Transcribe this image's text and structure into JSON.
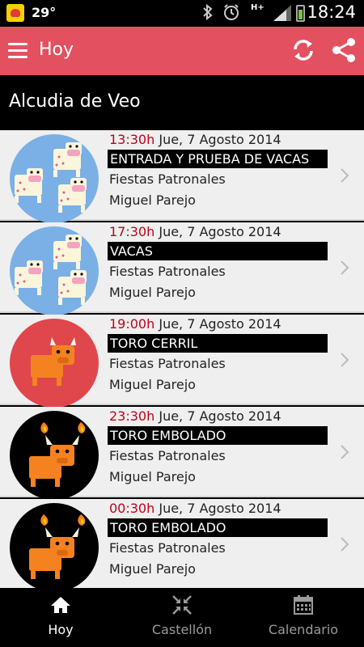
{
  "status_bar": {
    "temperature": "29°",
    "network": "H+",
    "time": "18:24",
    "icons": [
      "notification-icon",
      "bluetooth-icon",
      "alarm-icon",
      "signal-icon",
      "battery-icon"
    ]
  },
  "app_bar": {
    "title": "Hoy",
    "color": "#e3505f",
    "actions": [
      "refresh-icon",
      "share-icon"
    ]
  },
  "location": "Alcudia de Veo",
  "events": [
    {
      "time": "13:30h",
      "date": "Jue, 7 Agosto 2014",
      "name": "ENTRADA Y PRUEBA DE VACAS",
      "category": "Fiestas Patronales",
      "venue": "Miguel Parejo",
      "icon": "cows-icon"
    },
    {
      "time": "17:30h",
      "date": "Jue, 7 Agosto 2014",
      "name": "VACAS",
      "category": "Fiestas Patronales",
      "venue": "Miguel Parejo",
      "icon": "cows-icon"
    },
    {
      "time": "19:00h",
      "date": "Jue, 7 Agosto 2014",
      "name": "TORO CERRIL",
      "category": "Fiestas Patronales",
      "venue": "Miguel Parejo",
      "icon": "bull-icon"
    },
    {
      "time": "23:30h",
      "date": "Jue, 7 Agosto 2014",
      "name": "TORO EMBOLADO",
      "category": "Fiestas Patronales",
      "venue": "Miguel Parejo",
      "icon": "fire-bull-icon"
    },
    {
      "time": "00:30h",
      "date": "Jue, 7 Agosto 2014",
      "name": "TORO EMBOLADO",
      "category": "Fiestas Patronales",
      "venue": "Miguel Parejo",
      "icon": "fire-bull-icon"
    }
  ],
  "bottom_nav": {
    "tabs": [
      {
        "label": "Hoy",
        "icon": "home-icon",
        "active": true
      },
      {
        "label": "Castellón",
        "icon": "collapse-arrows-icon",
        "active": false
      },
      {
        "label": "Calendario",
        "icon": "calendar-icon",
        "active": false
      }
    ]
  },
  "colors": {
    "accent": "#e3505f",
    "time_text": "#c0001a",
    "cow_background": "#7ab0e6",
    "bull_background": "#e0474c",
    "fire_bull_background": "#000000",
    "bull_body": "#f58220"
  }
}
